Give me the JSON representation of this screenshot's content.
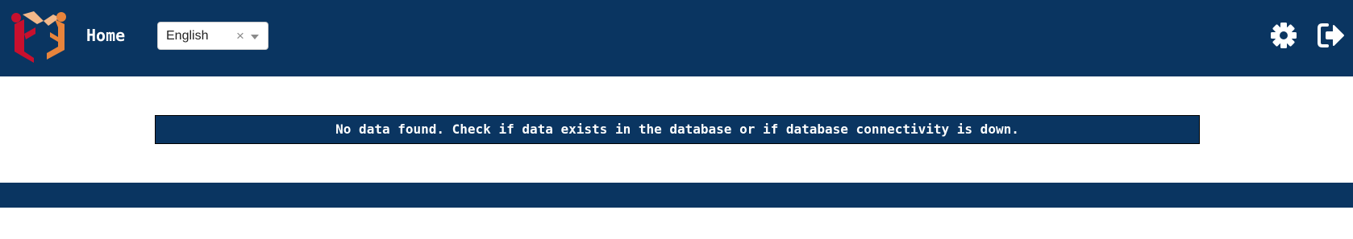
{
  "header": {
    "logo_icon": "cube-logo-icon",
    "home_label": "Home",
    "language": {
      "selected": "English",
      "clear_glyph": "×"
    },
    "settings_icon": "gear-icon",
    "logout_icon": "sign-out-icon"
  },
  "main": {
    "message": "No data found. Check if data exists in the database or if database connectivity is down."
  },
  "colors": {
    "navy": "#0a3561",
    "logo_red": "#c8102e",
    "logo_orange": "#e8843c"
  }
}
